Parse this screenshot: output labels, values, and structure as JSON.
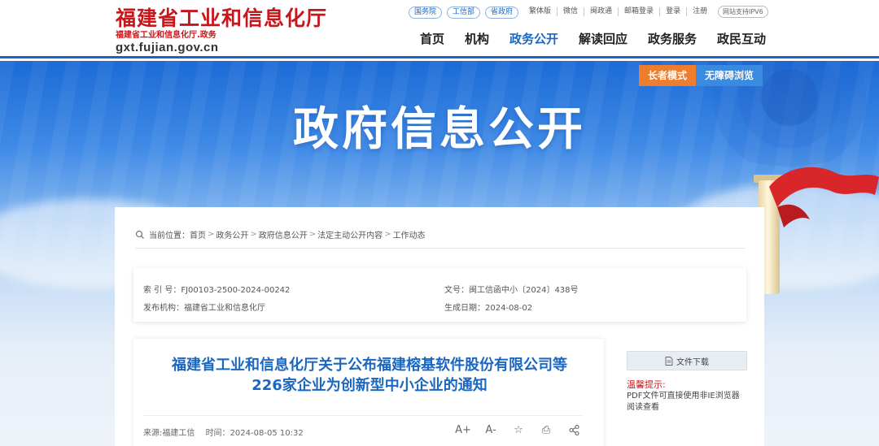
{
  "site": {
    "title": "福建省工业和信息化厅",
    "subtitle": "福建省工业和信息化厅.政务",
    "url": "gxt.fujian.gov.cn"
  },
  "portal_links": [
    "国务院",
    "工信部",
    "省政府"
  ],
  "top_links": [
    "繁体版",
    "微信",
    "闽政通",
    "邮箱登录",
    "登录",
    "注册"
  ],
  "ipv6_badge": "网站支持IPV6",
  "nav": [
    "首页",
    "机构",
    "政务公开",
    "解读回应",
    "政务服务",
    "政民互动"
  ],
  "nav_active_index": 2,
  "banner": {
    "title": "政府信息公开",
    "elder_mode": "长者模式",
    "accessibility": "无障碍浏览"
  },
  "breadcrumb": {
    "label": "当前位置：",
    "items": [
      "首页",
      "政务公开",
      "政府信息公开",
      "法定主动公开内容",
      "工作动态"
    ]
  },
  "meta": {
    "index_label": "索 引 号：",
    "index_value": "FJ00103-2500-2024-00242",
    "doc_no_label": "文号：",
    "doc_no_value": "闽工信函中小〔2024〕438号",
    "publisher_label": "发布机构：",
    "publisher_value": "福建省工业和信息化厅",
    "date_label": "生成日期：",
    "date_value": "2024-08-02"
  },
  "article": {
    "title_line1": "福建省工业和信息化厅关于公布福建榕基软件股份有限公司等",
    "title_line2": "226家企业为创新型中小企业的通知",
    "source": "来源:福建工信",
    "time_label": "时间：",
    "time_value": "2024-08-05 10:32",
    "tools": [
      "A+",
      "A-",
      "☆",
      "⎙",
      "⋄"
    ]
  },
  "sidebar": {
    "download": "文件下载",
    "tip_title": "温馨提示:",
    "tip_text": "PDF文件可直接使用非IE浏览器阅读查看"
  },
  "colors": {
    "brand_red": "#c8161d",
    "brand_blue": "#1a67c2",
    "elder_orange": "#ef7d2e"
  }
}
